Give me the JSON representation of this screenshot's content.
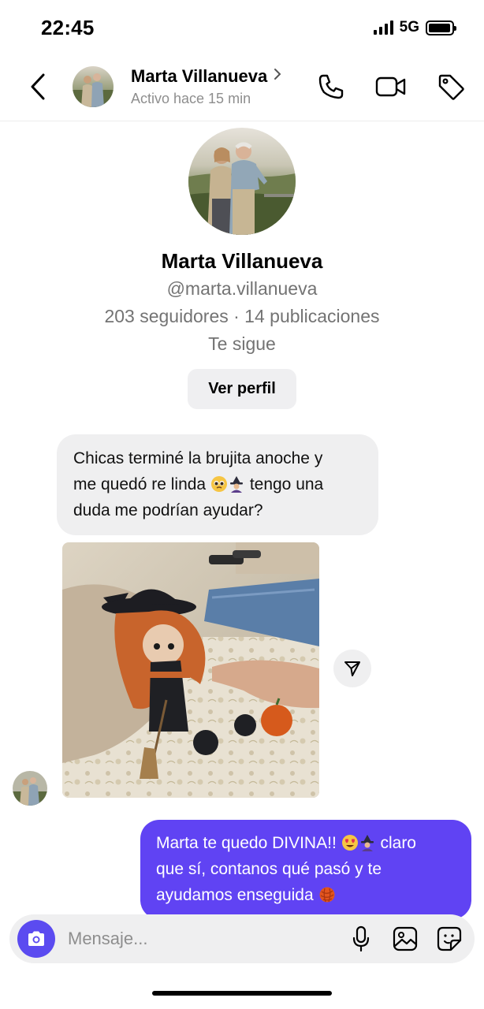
{
  "status_bar": {
    "time": "22:45",
    "network": "5G",
    "battery_level": 0.95
  },
  "header": {
    "contact_name": "Marta Villanueva",
    "contact_status": "Activo hace 15 min",
    "icons": [
      "back-arrow-icon",
      "chevron-right-icon",
      "phone-icon",
      "video-camera-icon",
      "tag-icon"
    ]
  },
  "profile": {
    "name": "Marta Villanueva",
    "handle": "@marta.villanueva",
    "stats": "203 seguidores · 14 publicaciones",
    "follows_you": "Te sigue",
    "view_profile_label": "Ver perfil"
  },
  "messages": [
    {
      "direction": "incoming",
      "lines": [
        "Chicas terminé la brujita anoche y",
        "me quedó re linda",
        "tengo una",
        "duda me podrían ayudar?"
      ],
      "emojis": [
        "pleading-face-emoji",
        "witch-emoji"
      ]
    },
    {
      "direction": "incoming",
      "type": "photo",
      "photo_subject": "crochet-witch-doll-photo",
      "action_icon": "share-send-icon"
    },
    {
      "direction": "outgoing",
      "lines": [
        "Marta te quedo DIVINA!!",
        "claro",
        "que sí, contanos qué pasó y te",
        "ayudamos enseguida"
      ],
      "emojis": [
        "heart-eyes-emoji",
        "witch-emoji",
        "yarn-emoji"
      ]
    }
  ],
  "composer": {
    "placeholder": "Mensaje...",
    "icons": [
      "camera-icon",
      "microphone-icon",
      "gallery-icon",
      "sticker-icon"
    ]
  },
  "colors": {
    "outgoing_bubble": "#6043f3",
    "incoming_bubble": "#efeff0",
    "camera_button": "#5b4bf0",
    "secondary_text": "#737373"
  }
}
